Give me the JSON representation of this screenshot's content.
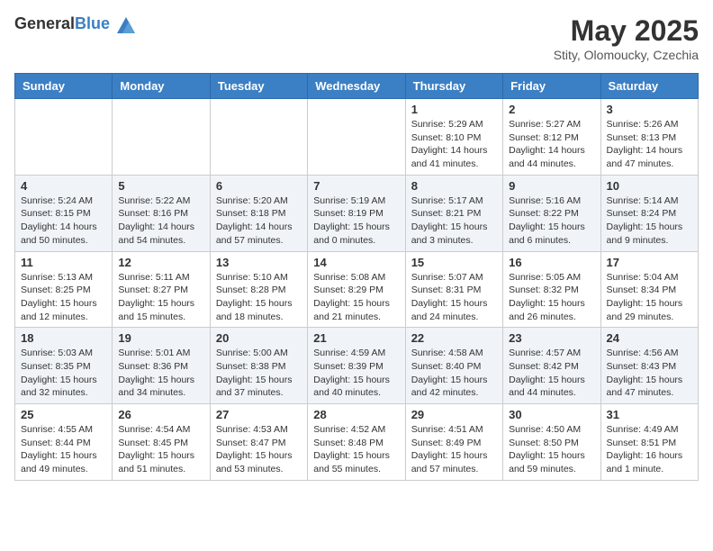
{
  "header": {
    "logo_general": "General",
    "logo_blue": "Blue",
    "month_title": "May 2025",
    "subtitle": "Stity, Olomoucky, Czechia"
  },
  "days_of_week": [
    "Sunday",
    "Monday",
    "Tuesday",
    "Wednesday",
    "Thursday",
    "Friday",
    "Saturday"
  ],
  "weeks": [
    [
      {
        "day": "",
        "info": ""
      },
      {
        "day": "",
        "info": ""
      },
      {
        "day": "",
        "info": ""
      },
      {
        "day": "",
        "info": ""
      },
      {
        "day": "1",
        "info": "Sunrise: 5:29 AM\nSunset: 8:10 PM\nDaylight: 14 hours\nand 41 minutes."
      },
      {
        "day": "2",
        "info": "Sunrise: 5:27 AM\nSunset: 8:12 PM\nDaylight: 14 hours\nand 44 minutes."
      },
      {
        "day": "3",
        "info": "Sunrise: 5:26 AM\nSunset: 8:13 PM\nDaylight: 14 hours\nand 47 minutes."
      }
    ],
    [
      {
        "day": "4",
        "info": "Sunrise: 5:24 AM\nSunset: 8:15 PM\nDaylight: 14 hours\nand 50 minutes."
      },
      {
        "day": "5",
        "info": "Sunrise: 5:22 AM\nSunset: 8:16 PM\nDaylight: 14 hours\nand 54 minutes."
      },
      {
        "day": "6",
        "info": "Sunrise: 5:20 AM\nSunset: 8:18 PM\nDaylight: 14 hours\nand 57 minutes."
      },
      {
        "day": "7",
        "info": "Sunrise: 5:19 AM\nSunset: 8:19 PM\nDaylight: 15 hours\nand 0 minutes."
      },
      {
        "day": "8",
        "info": "Sunrise: 5:17 AM\nSunset: 8:21 PM\nDaylight: 15 hours\nand 3 minutes."
      },
      {
        "day": "9",
        "info": "Sunrise: 5:16 AM\nSunset: 8:22 PM\nDaylight: 15 hours\nand 6 minutes."
      },
      {
        "day": "10",
        "info": "Sunrise: 5:14 AM\nSunset: 8:24 PM\nDaylight: 15 hours\nand 9 minutes."
      }
    ],
    [
      {
        "day": "11",
        "info": "Sunrise: 5:13 AM\nSunset: 8:25 PM\nDaylight: 15 hours\nand 12 minutes."
      },
      {
        "day": "12",
        "info": "Sunrise: 5:11 AM\nSunset: 8:27 PM\nDaylight: 15 hours\nand 15 minutes."
      },
      {
        "day": "13",
        "info": "Sunrise: 5:10 AM\nSunset: 8:28 PM\nDaylight: 15 hours\nand 18 minutes."
      },
      {
        "day": "14",
        "info": "Sunrise: 5:08 AM\nSunset: 8:29 PM\nDaylight: 15 hours\nand 21 minutes."
      },
      {
        "day": "15",
        "info": "Sunrise: 5:07 AM\nSunset: 8:31 PM\nDaylight: 15 hours\nand 24 minutes."
      },
      {
        "day": "16",
        "info": "Sunrise: 5:05 AM\nSunset: 8:32 PM\nDaylight: 15 hours\nand 26 minutes."
      },
      {
        "day": "17",
        "info": "Sunrise: 5:04 AM\nSunset: 8:34 PM\nDaylight: 15 hours\nand 29 minutes."
      }
    ],
    [
      {
        "day": "18",
        "info": "Sunrise: 5:03 AM\nSunset: 8:35 PM\nDaylight: 15 hours\nand 32 minutes."
      },
      {
        "day": "19",
        "info": "Sunrise: 5:01 AM\nSunset: 8:36 PM\nDaylight: 15 hours\nand 34 minutes."
      },
      {
        "day": "20",
        "info": "Sunrise: 5:00 AM\nSunset: 8:38 PM\nDaylight: 15 hours\nand 37 minutes."
      },
      {
        "day": "21",
        "info": "Sunrise: 4:59 AM\nSunset: 8:39 PM\nDaylight: 15 hours\nand 40 minutes."
      },
      {
        "day": "22",
        "info": "Sunrise: 4:58 AM\nSunset: 8:40 PM\nDaylight: 15 hours\nand 42 minutes."
      },
      {
        "day": "23",
        "info": "Sunrise: 4:57 AM\nSunset: 8:42 PM\nDaylight: 15 hours\nand 44 minutes."
      },
      {
        "day": "24",
        "info": "Sunrise: 4:56 AM\nSunset: 8:43 PM\nDaylight: 15 hours\nand 47 minutes."
      }
    ],
    [
      {
        "day": "25",
        "info": "Sunrise: 4:55 AM\nSunset: 8:44 PM\nDaylight: 15 hours\nand 49 minutes."
      },
      {
        "day": "26",
        "info": "Sunrise: 4:54 AM\nSunset: 8:45 PM\nDaylight: 15 hours\nand 51 minutes."
      },
      {
        "day": "27",
        "info": "Sunrise: 4:53 AM\nSunset: 8:47 PM\nDaylight: 15 hours\nand 53 minutes."
      },
      {
        "day": "28",
        "info": "Sunrise: 4:52 AM\nSunset: 8:48 PM\nDaylight: 15 hours\nand 55 minutes."
      },
      {
        "day": "29",
        "info": "Sunrise: 4:51 AM\nSunset: 8:49 PM\nDaylight: 15 hours\nand 57 minutes."
      },
      {
        "day": "30",
        "info": "Sunrise: 4:50 AM\nSunset: 8:50 PM\nDaylight: 15 hours\nand 59 minutes."
      },
      {
        "day": "31",
        "info": "Sunrise: 4:49 AM\nSunset: 8:51 PM\nDaylight: 16 hours\nand 1 minute."
      }
    ]
  ]
}
